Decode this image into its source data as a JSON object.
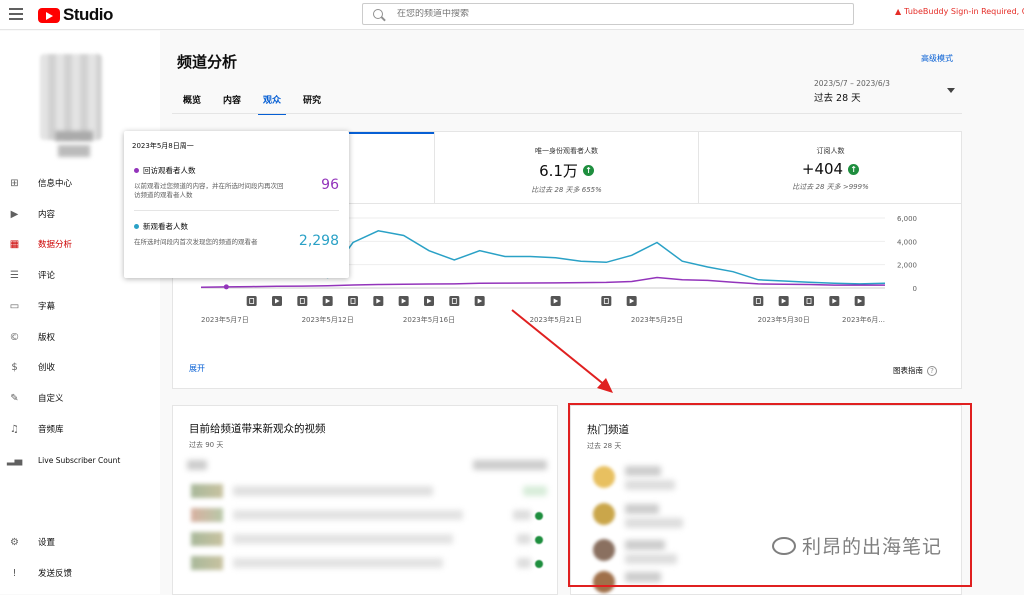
{
  "topbar": {
    "logo_text": "Studio",
    "search_placeholder": "在您的频道中搜索",
    "warning_text": "TubeBuddy Sign-in Required, Click"
  },
  "sidebar": {
    "items": [
      {
        "label": "信息中心",
        "icon": "dashboard-icon"
      },
      {
        "label": "内容",
        "icon": "content-icon"
      },
      {
        "label": "数据分析",
        "icon": "analytics-icon",
        "active": true
      },
      {
        "label": "评论",
        "icon": "comments-icon"
      },
      {
        "label": "字幕",
        "icon": "subtitles-icon"
      },
      {
        "label": "版权",
        "icon": "copyright-icon"
      },
      {
        "label": "创收",
        "icon": "monetization-icon"
      },
      {
        "label": "自定义",
        "icon": "customization-icon"
      },
      {
        "label": "音频库",
        "icon": "audio-library-icon"
      },
      {
        "label": "Live Subscriber Count",
        "icon": "live-count-icon"
      }
    ],
    "bottom": [
      {
        "label": "设置",
        "icon": "settings-icon"
      },
      {
        "label": "发送反馈",
        "icon": "feedback-icon"
      }
    ]
  },
  "header": {
    "title": "频道分析",
    "advanced_mode": "高级模式",
    "tabs": [
      "概览",
      "内容",
      "观众",
      "研究"
    ],
    "active_tab": "观众",
    "date_range": "2023/5/7 – 2023/6/3",
    "date_period": "过去 28 天"
  },
  "kpis": [
    {
      "label": "唯一身份观看者人数",
      "value": "6.1万",
      "sub": "比过去 28 天多 655%"
    },
    {
      "label": "订阅人数",
      "value": "+404",
      "sub": "比过去 28 天多 >999%"
    }
  ],
  "tooltip": {
    "date": "2023年5月8日周一",
    "rows": [
      {
        "name": "回访观看者人数",
        "desc": "以前观看过您频道的内容，并在所选时间段内再次回访频道的观看者人数",
        "value": "96",
        "color": "#9334bb"
      },
      {
        "name": "新观看者人数",
        "desc": "在所选时间段内首次发现您的频道的观看者",
        "value": "2,298",
        "color": "#2aa1c6"
      }
    ]
  },
  "chart_data": {
    "type": "line",
    "x": [
      "2023-05-07",
      "2023-05-08",
      "2023-05-09",
      "2023-05-10",
      "2023-05-11",
      "2023-05-12",
      "2023-05-13",
      "2023-05-14",
      "2023-05-15",
      "2023-05-16",
      "2023-05-17",
      "2023-05-18",
      "2023-05-19",
      "2023-05-20",
      "2023-05-21",
      "2023-05-22",
      "2023-05-23",
      "2023-05-24",
      "2023-05-25",
      "2023-05-26",
      "2023-05-27",
      "2023-05-28",
      "2023-05-29",
      "2023-05-30",
      "2023-05-31",
      "2023-06-01",
      "2023-06-02",
      "2023-06-03"
    ],
    "series": [
      {
        "name": "新观看者人数",
        "color": "#2aa1c6",
        "values": [
          4300,
          2298,
          1200,
          1800,
          1500,
          900,
          3900,
          4900,
          4500,
          3200,
          2400,
          3200,
          2700,
          2700,
          2600,
          2300,
          2200,
          2800,
          3900,
          2300,
          1800,
          1400,
          700,
          600,
          500,
          400,
          350,
          400
        ]
      },
      {
        "name": "回访观看者人数",
        "color": "#9334bb",
        "values": [
          60,
          96,
          120,
          150,
          160,
          200,
          260,
          300,
          320,
          340,
          350,
          400,
          420,
          430,
          440,
          460,
          480,
          560,
          900,
          700,
          650,
          500,
          350,
          320,
          300,
          250,
          250,
          250
        ]
      }
    ],
    "x_tick_labels": [
      "2023年5月7日",
      "2023年5月12日",
      "2023年5月16日",
      "2023年5月21日",
      "2023年5月25日",
      "2023年5月30日",
      "2023年6月..."
    ],
    "y_ticks": [
      "6,000",
      "4,000",
      "2,000",
      "0"
    ],
    "ylim": [
      0,
      6000
    ],
    "markers": [
      {
        "date": "2023-05-09",
        "kind": "doc"
      },
      {
        "date": "2023-05-10",
        "kind": "play"
      },
      {
        "date": "2023-05-11",
        "kind": "doc"
      },
      {
        "date": "2023-05-12",
        "kind": "play"
      },
      {
        "date": "2023-05-13",
        "kind": "doc"
      },
      {
        "date": "2023-05-14",
        "kind": "play"
      },
      {
        "date": "2023-05-15",
        "kind": "play"
      },
      {
        "date": "2023-05-16",
        "kind": "play"
      },
      {
        "date": "2023-05-17",
        "kind": "doc"
      },
      {
        "date": "2023-05-18",
        "kind": "play"
      },
      {
        "date": "2023-05-21",
        "kind": "play"
      },
      {
        "date": "2023-05-23",
        "kind": "doc"
      },
      {
        "date": "2023-05-24",
        "kind": "play"
      },
      {
        "date": "2023-05-29",
        "kind": "doc"
      },
      {
        "date": "2023-05-30",
        "kind": "play"
      },
      {
        "date": "2023-05-31",
        "kind": "doc"
      },
      {
        "date": "2023-06-01",
        "kind": "play"
      },
      {
        "date": "2023-06-02",
        "kind": "play"
      }
    ]
  },
  "chart_footer": {
    "expand": "展开",
    "guide": "图表指南"
  },
  "panel_videos": {
    "title": "目前给频道带来新观众的视频",
    "subtitle": "过去 90 天"
  },
  "panel_channels": {
    "title": "热门频道",
    "subtitle": "过去 28 天"
  },
  "watermark": "利昂的出海笔记"
}
